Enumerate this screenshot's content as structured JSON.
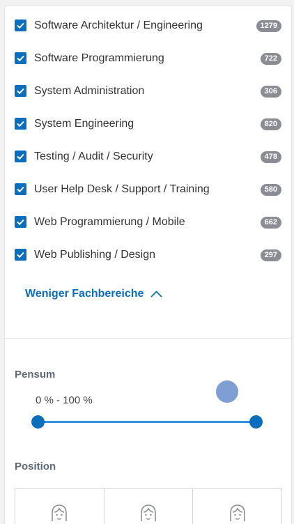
{
  "filters": [
    {
      "label": "Software Architektur / Engineering",
      "count": "1279",
      "checked": true
    },
    {
      "label": "Software Programmierung",
      "count": "722",
      "checked": true
    },
    {
      "label": "System Administration",
      "count": "306",
      "checked": true
    },
    {
      "label": "System Engineering",
      "count": "820",
      "checked": true
    },
    {
      "label": "Testing / Audit / Security",
      "count": "478",
      "checked": true
    },
    {
      "label": "User Help Desk / Support / Training",
      "count": "580",
      "checked": true
    },
    {
      "label": "Web Programmierung / Mobile",
      "count": "662",
      "checked": true
    },
    {
      "label": "Web Publishing / Design",
      "count": "297",
      "checked": true
    }
  ],
  "less_link": {
    "label": "Weniger Fachbereiche",
    "icon": "chevron-up-icon"
  },
  "pensum": {
    "title": "Pensum",
    "range_text": "0 % - 100 %",
    "min_value": 0,
    "max_value": 100
  },
  "position": {
    "title": "Position",
    "options": [
      {
        "icon": "person-avatar-icon"
      },
      {
        "icon": "person-avatar-icon"
      },
      {
        "icon": "person-avatar-icon"
      }
    ]
  },
  "colors": {
    "accent": "#0a6ebd",
    "badge": "#8a8e94",
    "slider_track": "#2f8fe0",
    "tooltip": "#7f9fd4"
  }
}
